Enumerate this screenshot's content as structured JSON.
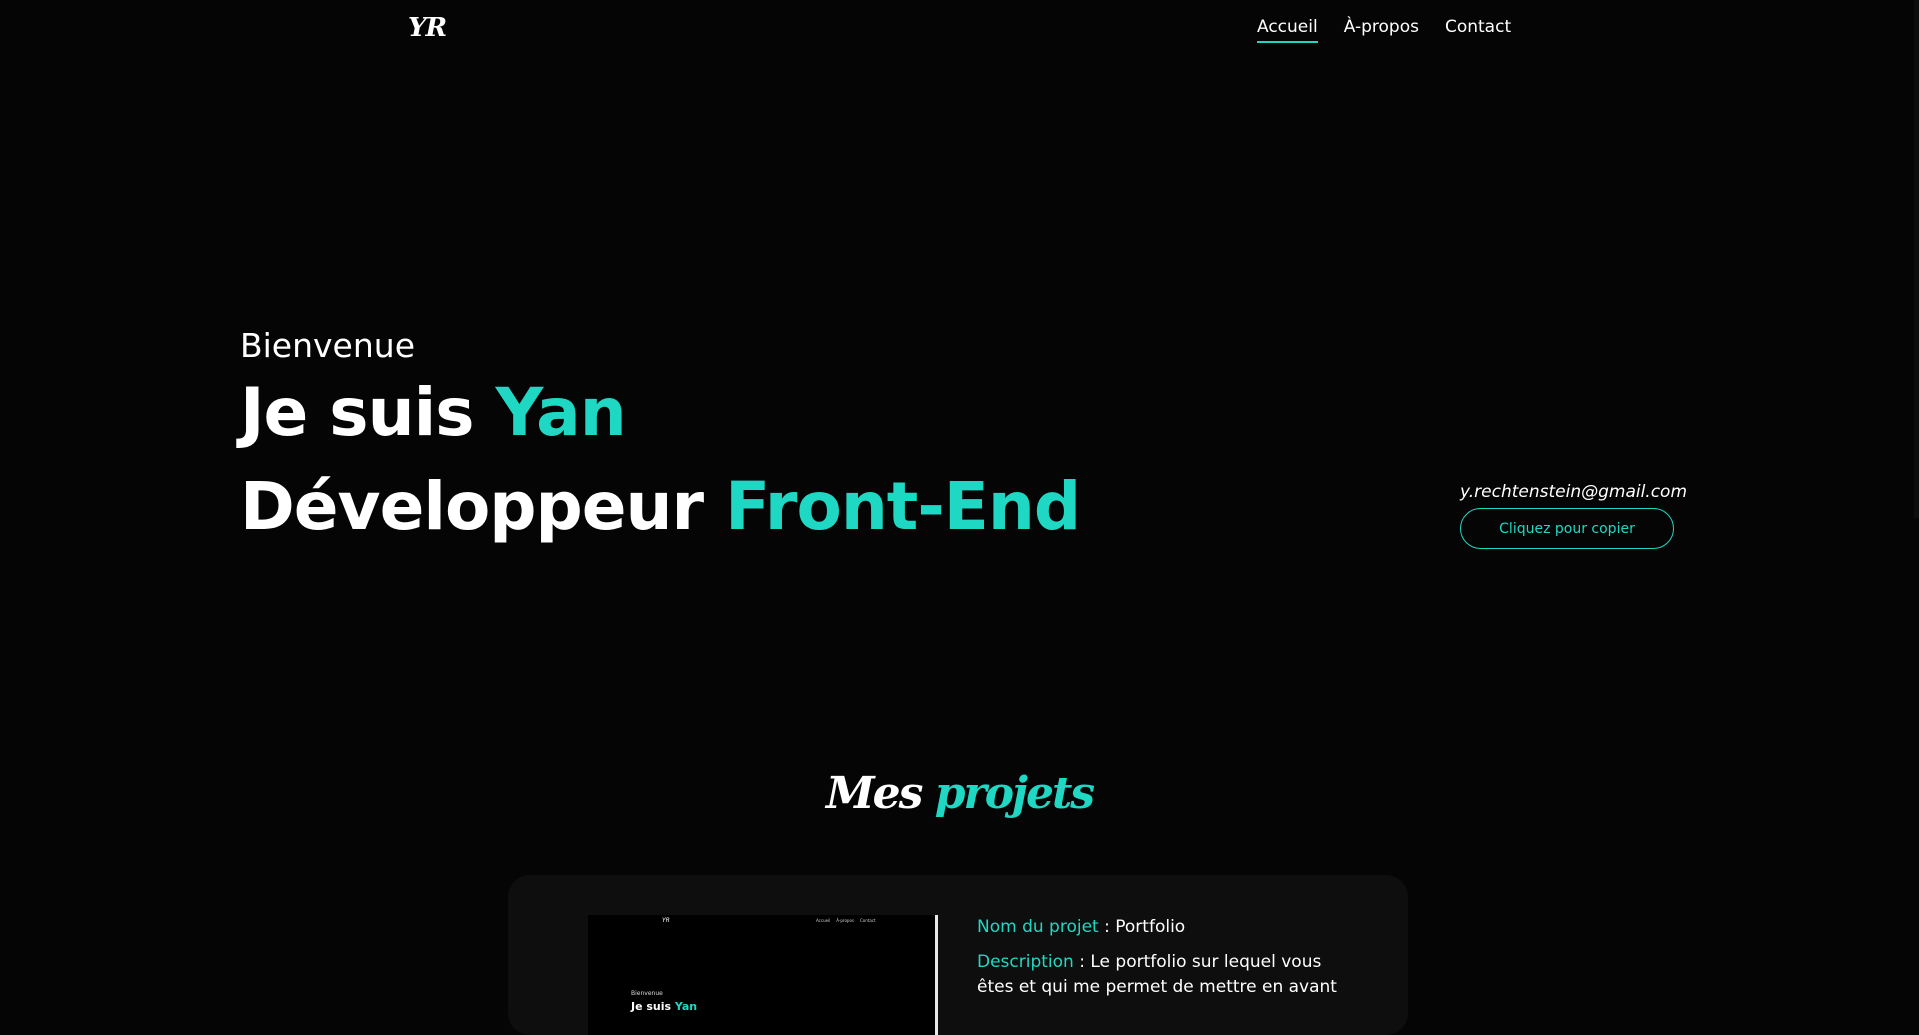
{
  "header": {
    "logo": "YR",
    "nav": [
      {
        "label": "Accueil",
        "active": true
      },
      {
        "label": "À-propos",
        "active": false
      },
      {
        "label": "Contact",
        "active": false
      }
    ]
  },
  "hero": {
    "welcome": "Bienvenue",
    "line1_prefix": "Je suis ",
    "line1_accent": "Yan",
    "line2_prefix": "Développeur ",
    "line2_accent": "Front-End"
  },
  "contact": {
    "email": "y.rechtenstein@gmail.com",
    "copy_button_label": "Cliquez pour copier"
  },
  "projects": {
    "title_word1": "Mes",
    "title_word2": "projets",
    "items": [
      {
        "name_label": "Nom du projet",
        "name_value": "Portfolio",
        "description_label": "Description",
        "description_value": "Le portfolio sur lequel vous êtes et qui me permet de mettre en avant",
        "thumbnail": {
          "logo": "YR",
          "nav": [
            "Accueil",
            "À-propos",
            "Contact"
          ],
          "welcome": "Bienvenue",
          "line_prefix": "Je suis ",
          "line_accent": "Yan"
        }
      }
    ]
  },
  "colors": {
    "accent": "#1fd8c4",
    "background": "#050505",
    "card": "#0e0e0e"
  }
}
